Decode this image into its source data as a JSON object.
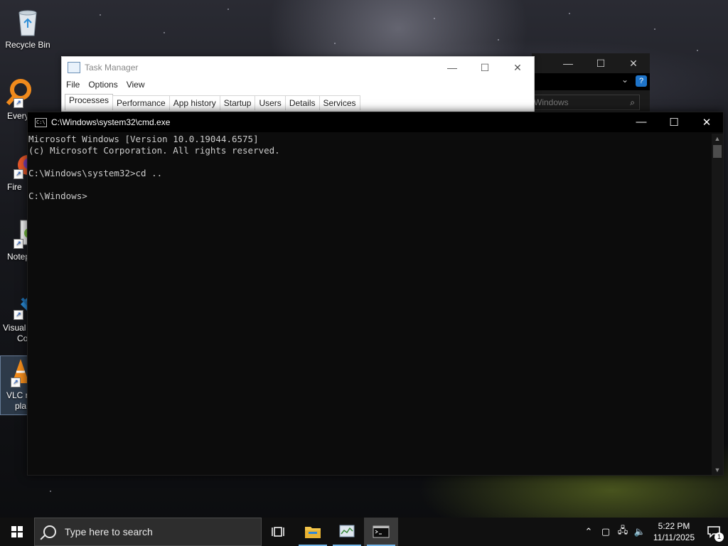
{
  "desktop": {
    "icons": [
      {
        "label": "Recycle Bin",
        "icon": "recycle-bin-icon"
      },
      {
        "label": "Every",
        "icon": "everything-search-icon"
      },
      {
        "label": "Fire",
        "icon": "firefox-icon"
      },
      {
        "label": "Notep",
        "icon": "notepad-plus-plus-icon"
      },
      {
        "label": "Visual",
        "label2": "Co",
        "icon": "vscode-icon"
      },
      {
        "label": "VLC r",
        "label2": "pla",
        "icon": "vlc-icon"
      }
    ]
  },
  "task_manager": {
    "title": "Task Manager",
    "menu": [
      "File",
      "Options",
      "View"
    ],
    "tabs": [
      "Processes",
      "Performance",
      "App history",
      "Startup",
      "Users",
      "Details",
      "Services"
    ],
    "active_tab": "Processes",
    "search_placeholder": "Windows"
  },
  "cmd": {
    "title": "C:\\Windows\\system32\\cmd.exe",
    "lines": [
      "Microsoft Windows [Version 10.0.19044.6575]",
      "(c) Microsoft Corporation. All rights reserved.",
      "",
      "C:\\Windows\\system32>cd ..",
      "",
      "C:\\Windows>"
    ]
  },
  "taskbar": {
    "search_placeholder": "Type here to search",
    "apps": [
      {
        "name": "task-view-icon",
        "active": false
      },
      {
        "name": "file-explorer-icon",
        "active": false,
        "open": true
      },
      {
        "name": "task-manager-icon",
        "active": false,
        "open": true
      },
      {
        "name": "command-prompt-icon",
        "active": true,
        "open": true
      }
    ],
    "time": "5:22 PM",
    "date": "11/11/2025",
    "notification_count": "1"
  },
  "colors": {
    "console_bg": "#0c0c0c",
    "console_text": "#cccccc",
    "taskbar_bg": "#101010",
    "accent": "#76b9ed"
  }
}
